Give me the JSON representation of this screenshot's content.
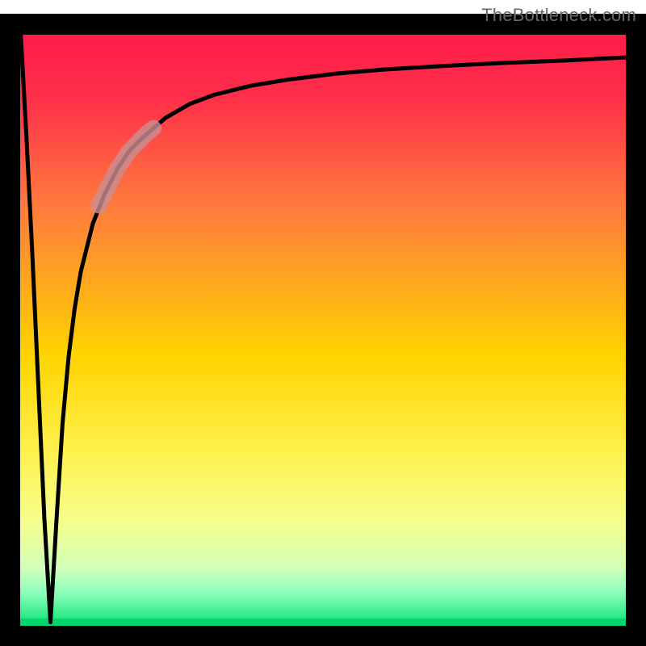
{
  "attribution": "TheBottleneck.com",
  "colors": {
    "gradient_top": "#ff1a4a",
    "gradient_mid": "#ffd400",
    "gradient_bottom": "#00e070",
    "curve": "#000000",
    "highlight": "#c98f94",
    "frame": "#000000"
  },
  "chart_data": {
    "type": "line",
    "title": "",
    "xlabel": "",
    "ylabel": "",
    "xlim": [
      0,
      100
    ],
    "ylim": [
      0,
      100
    ],
    "grid": false,
    "legend": false,
    "series": [
      {
        "name": "bottleneck-curve-left-branch",
        "x": [
          0,
          1,
          2,
          3,
          4,
          5
        ],
        "values": [
          100,
          82,
          62,
          40,
          18,
          1
        ]
      },
      {
        "name": "bottleneck-curve-right-branch",
        "x": [
          5,
          6,
          7,
          8,
          9,
          10,
          12,
          14,
          16,
          18,
          20,
          24,
          28,
          32,
          38,
          44,
          52,
          60,
          70,
          80,
          90,
          100
        ],
        "values": [
          1,
          18,
          34,
          45,
          53,
          59,
          67,
          72,
          76,
          79,
          81,
          84.5,
          86.8,
          88.3,
          89.8,
          90.8,
          91.8,
          92.5,
          93.1,
          93.6,
          94.0,
          94.5
        ]
      },
      {
        "name": "highlighted-segment",
        "x": [
          13,
          14,
          15,
          16,
          17,
          18,
          19,
          20,
          21,
          22
        ],
        "values": [
          70.0,
          72.0,
          74.0,
          76.0,
          77.5,
          79.0,
          80.0,
          81.0,
          82.0,
          82.8
        ]
      }
    ]
  }
}
